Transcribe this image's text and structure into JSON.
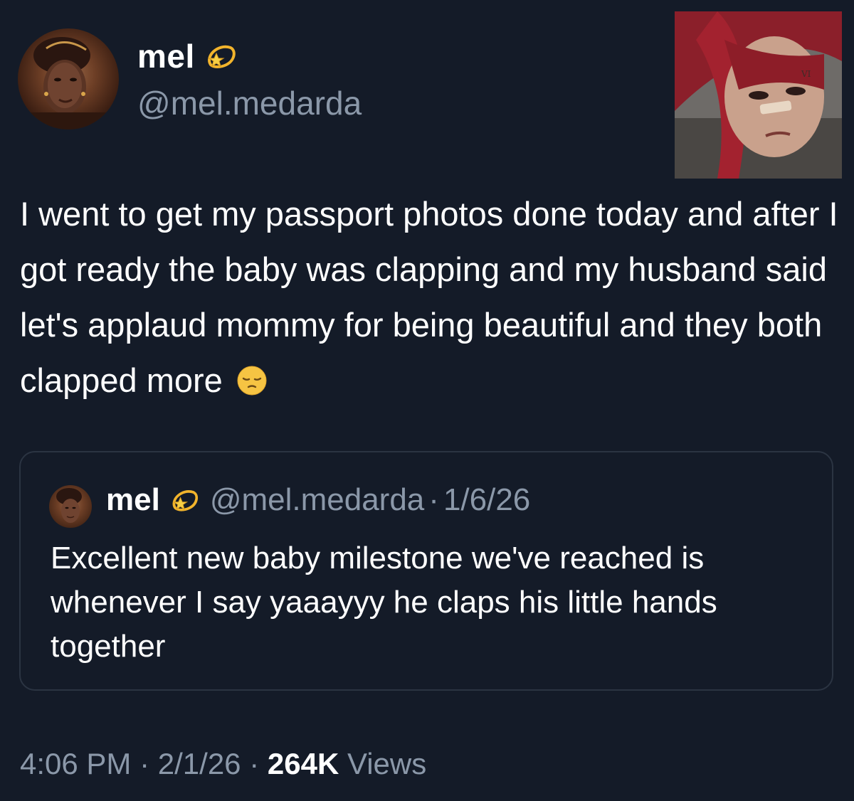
{
  "author": {
    "name": "mel",
    "handle": "@mel.medarda",
    "badge_icon": "dizzy-star-emoji-icon"
  },
  "post": {
    "text": "I went to get my passport photos done today and after I got ready the baby was clapping and my husband said let's applaud mommy for being beautiful and they both clapped more",
    "emoji": "pensive-face-emoji-icon"
  },
  "quoted_post": {
    "name": "mel",
    "handle": "@mel.medarda",
    "separator": "·",
    "date": "1/6/26",
    "text": "Excellent new baby milestone we've reached is whenever I say yaaayyy he claps his little hands together"
  },
  "meta": {
    "time": "4:06 PM",
    "separator": "·",
    "date": "2/1/26",
    "views_count": "264K",
    "views_label": "Views"
  },
  "colors": {
    "background": "#141b28",
    "text_primary": "#ffffff",
    "text_secondary": "#8b98a9",
    "card_border": "#2b3442"
  }
}
